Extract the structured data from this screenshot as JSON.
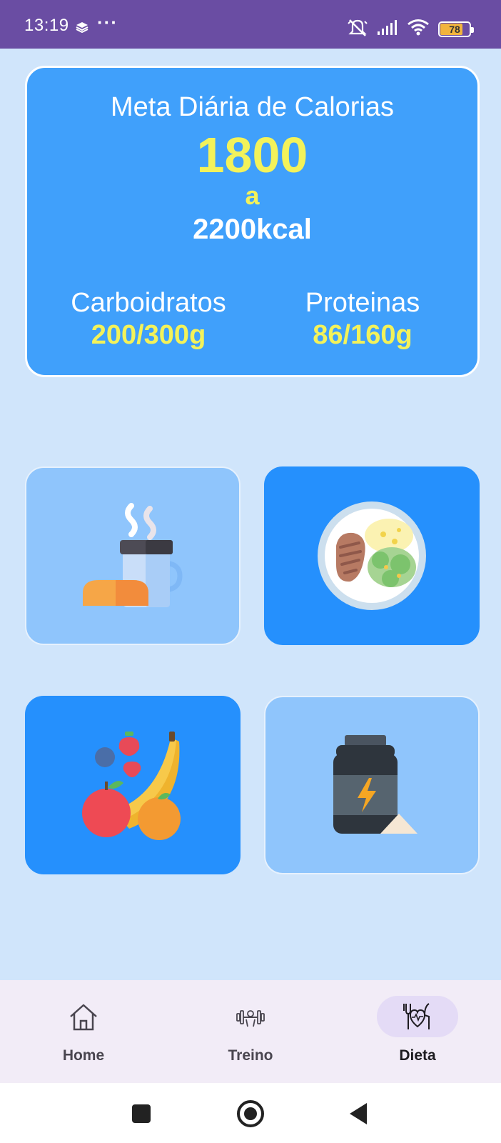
{
  "status_bar": {
    "time": "13:19",
    "more": "···",
    "battery_level": "78",
    "background_color": "#6a4da3"
  },
  "calorie_card": {
    "title": "Meta Diária de Calorias",
    "min_value": "1800",
    "separator": "a",
    "max_value": "2200kcal",
    "background_color": "#40a0fb",
    "highlight_color": "#f3f25a",
    "macros": [
      {
        "label": "Carboidratos",
        "value": "200/300g"
      },
      {
        "label": "Proteinas",
        "value": "86/160g"
      }
    ]
  },
  "meal_tiles": [
    {
      "icon": "breakfast-coffee-bread-icon",
      "style": "light"
    },
    {
      "icon": "lunch-plate-icon",
      "style": "dark"
    },
    {
      "icon": "fruits-icon",
      "style": "dark"
    },
    {
      "icon": "supplement-jar-icon",
      "style": "light"
    }
  ],
  "bottom_nav": {
    "items": [
      {
        "label": "Home",
        "icon": "home-icon",
        "active": false
      },
      {
        "label": "Treino",
        "icon": "dumbbell-icon",
        "active": false
      },
      {
        "label": "Dieta",
        "icon": "diet-heart-icon",
        "active": true
      }
    ]
  }
}
